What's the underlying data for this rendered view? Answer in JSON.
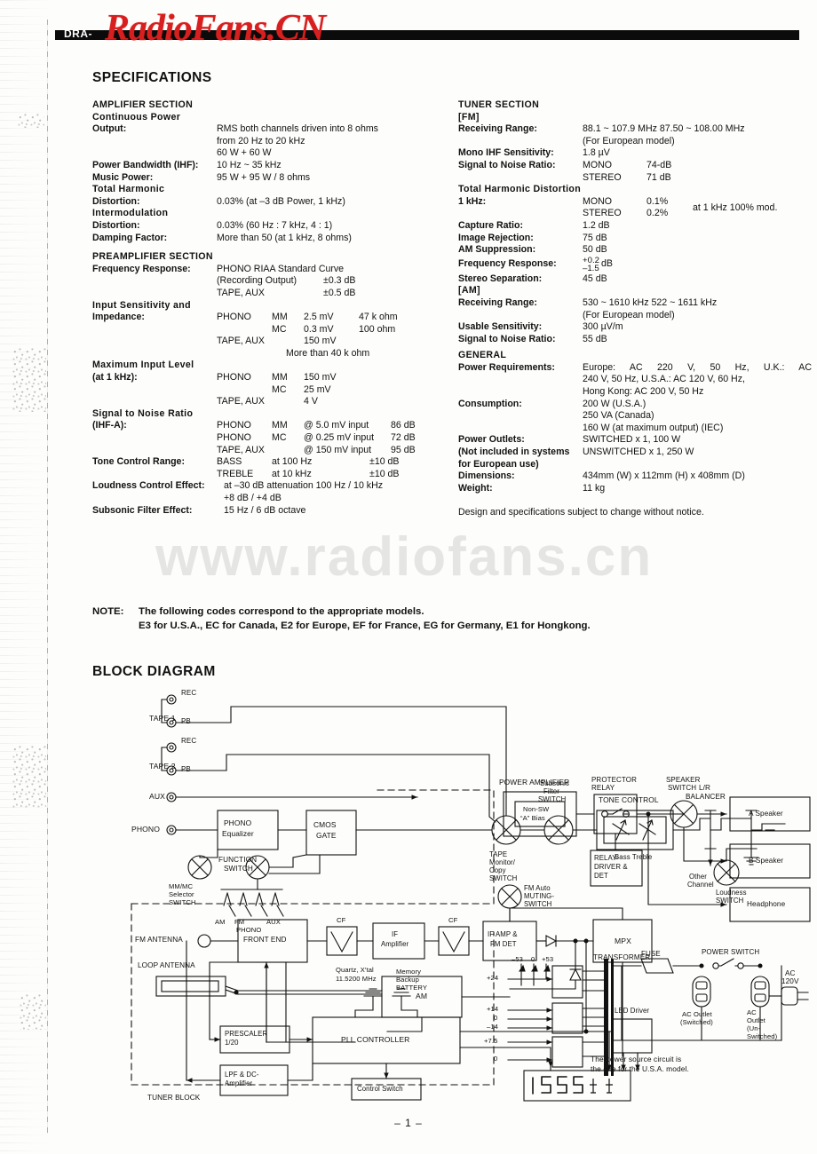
{
  "header": {
    "model_code": "DRA-",
    "watermark_top": "RadioFans.CN",
    "watermark_body": "www.radiofans.cn"
  },
  "specifications": {
    "title": "SPECIFICATIONS",
    "amplifier": {
      "heading": "AMPLIFIER SECTION",
      "continuous_power_head": "Continuous Power",
      "output_label": "Output:",
      "output_lines": [
        "RMS both channels driven into 8 ohms",
        "from 20 Hz to 20 kHz",
        "60 W + 60 W"
      ],
      "power_bandwidth_label": "Power Bandwidth (IHF):",
      "power_bandwidth_value": "10 Hz ~ 35 kHz",
      "music_power_label": "Music Power:",
      "music_power_value": "95 W + 95 W / 8 ohms",
      "thd_head": "Total Harmonic",
      "thd_label": "Distortion:",
      "thd_value": "0.03% (at –3 dB Power, 1 kHz)",
      "imd_head": "Intermodulation",
      "imd_label": "Distortion:",
      "imd_value": "0.03% (60 Hz : 7 kHz, 4 : 1)",
      "damping_label": "Damping Factor:",
      "damping_value": "More than 50 (at 1 kHz, 8 ohms)"
    },
    "preamplifier": {
      "heading": "PREAMPLIFIER SECTION",
      "freq_resp_label": "Frequency Response:",
      "freq_resp_line1": "PHONO RIAA Standard Curve",
      "freq_resp_line2_left": "(Recording Output)",
      "freq_resp_line2_right": "±0.3 dB",
      "freq_resp_line3_left": "TAPE, AUX",
      "freq_resp_line3_right": "±0.5 dB",
      "input_sens_head": "Input Sensitivity and",
      "input_sens_label": "Impedance:",
      "input_sens_rows": [
        {
          "c1": "PHONO",
          "c2": "MM",
          "c3": "2.5 mV",
          "c4": "47 k ohm"
        },
        {
          "c1": "",
          "c2": "MC",
          "c3": "0.3 mV",
          "c4": "100 ohm"
        },
        {
          "c1": "TAPE, AUX",
          "c2": "",
          "c3": "150 mV",
          "c4": ""
        }
      ],
      "input_sens_tail": "More than 40 k ohm",
      "max_input_head": "Maximum Input Level",
      "max_input_label": "(at 1 kHz):",
      "max_input_rows": [
        {
          "c1": "PHONO",
          "c2": "MM",
          "c3": "150 mV"
        },
        {
          "c1": "",
          "c2": "MC",
          "c3": "25 mV"
        },
        {
          "c1": "TAPE, AUX",
          "c2": "",
          "c3": "4 V"
        }
      ],
      "snr_head": "Signal to Noise Ratio",
      "snr_label": "(IHF-A):",
      "snr_rows": [
        {
          "c1": "PHONO",
          "c2": "MM",
          "c3": "@ 5.0 mV input",
          "c4": "86 dB"
        },
        {
          "c1": "PHONO",
          "c2": "MC",
          "c3": "@ 0.25 mV input",
          "c4": "72 dB"
        },
        {
          "c1": "TAPE, AUX",
          "c2": "",
          "c3": "@ 150 mV input",
          "c4": "95 dB"
        }
      ],
      "tone_label": "Tone Control Range:",
      "tone_rows": [
        {
          "c1": "BASS",
          "c2": "at 100 Hz",
          "c3": "±10 dB"
        },
        {
          "c1": "TREBLE",
          "c2": "at 10 kHz",
          "c3": "±10 dB"
        }
      ],
      "loudness_label": "Loudness Control Effect:",
      "loudness_line1": "at –30 dB attenuation  100 Hz / 10 kHz",
      "loudness_line2": "+8 dB / +4 dB",
      "subsonic_label": "Subsonic Filter Effect:",
      "subsonic_value": "15 Hz / 6 dB octave"
    },
    "tuner": {
      "heading": "TUNER SECTION",
      "fm_heading": "[FM]",
      "recv_label": "Receiving Range:",
      "recv_line1": "88.1 ~ 107.9 MHz 87.50 ~ 108.00 MHz",
      "recv_line2": "(For European model)",
      "mono_sens_label": "Mono IHF Sensitivity:",
      "mono_sens_value": "1.8 µV",
      "snr_label": "Signal to Noise Ratio:",
      "snr_rows": [
        {
          "c1": "MONO",
          "c2": "74-dB"
        },
        {
          "c1": "STEREO",
          "c2": "71 dB"
        }
      ],
      "thd_head": "Total Harmonic Distortion",
      "thd_label": "1 kHz:",
      "thd_rows": [
        {
          "c1": "MONO",
          "c2": "0.1%"
        },
        {
          "c1": "STEREO",
          "c2": "0.2%"
        }
      ],
      "thd_note": "at 1 kHz 100% mod.",
      "capture_label": "Capture Ratio:",
      "capture_value": "1.2 dB",
      "image_label": "Image Rejection:",
      "image_value": "75 dB",
      "amsup_label": "AM Suppression:",
      "amsup_value": "50 dB",
      "freq_label": "Frequency Response:",
      "freq_plus": "+0.2",
      "freq_minus": "–1.5",
      "freq_unit": "dB",
      "sep_label": "Stereo Separation:",
      "sep_value": "45 dB",
      "am_heading": "[AM]",
      "am_recv_label": "Receiving Range:",
      "am_recv_line1": "530  ~  1610  kHz  522  ~  1611  kHz",
      "am_recv_line2": "(For European model)",
      "usable_label": "Usable Sensitivity:",
      "usable_value": "300 µV/m",
      "am_snr_label": "Signal to Noise Ratio:",
      "am_snr_value": "55 dB"
    },
    "general": {
      "heading": "GENERAL",
      "power_label": "Power Requirements:",
      "power_lines": [
        "Europe: AC 220 V, 50 Hz, U.K.: AC",
        "240 V, 50 Hz, U.S.A.: AC 120 V, 60 Hz,",
        "Hong Kong: AC 200 V, 50 Hz"
      ],
      "consumption_label": "Consumption:",
      "consumption_lines": [
        "200 W (U.S.A.)",
        "250 VA (Canada)",
        "160 W (at maximum output) (IEC)"
      ],
      "outlets_label": "Power Outlets:",
      "outlets_note1": "(Not included in systems",
      "outlets_note2": "for European use)",
      "outlets_value1": "SWITCHED x 1, 100 W",
      "outlets_value2": "UNSWITCHED x 1, 250 W",
      "dimensions_label": "Dimensions:",
      "dimensions_value": "434mm (W) x 112mm (H) x 408mm (D)",
      "weight_label": "Weight:",
      "weight_value": "11 kg",
      "design_note": "Design and specifications subject to change without notice."
    }
  },
  "note": {
    "label": "NOTE:",
    "line1": "The following codes correspond to the appropriate models.",
    "line2": "E3 for U.S.A., EC for Canada, E2 for Europe, EF for France, EG for Germany, E1 for Hongkong."
  },
  "block_diagram": {
    "title": "BLOCK DIAGRAM",
    "labels": {
      "tape1": "TAPE 1",
      "tape2": "TAPE 2",
      "rec": "REC",
      "pb": "PB",
      "aux": "AUX",
      "phono": "PHONO",
      "phono_equalizer_l1": "PHONO",
      "phono_equalizer_l2": "Equalizer",
      "cmos_gate_l1": "CMOS",
      "cmos_gate_l2": "GATE",
      "function_switch_l1": "FUNCTION",
      "function_switch_l2": "SWITCH",
      "mmmc_l1": "MM/MC",
      "mmmc_l2": "Selector",
      "mmmc_l3": "SWITCH",
      "src_am": "AM",
      "src_fm": "FM",
      "src_aux": "AUX",
      "src_phono": "PHONO",
      "tape_monitor_l1": "TAPE",
      "tape_monitor_l2": "Monitor/",
      "tape_monitor_l3": "Copy",
      "tape_monitor_l4": "SWITCH",
      "subsonic_l1": "Subsonic",
      "subsonic_l2": "Filter",
      "subsonic_l3": "SWITCH",
      "tone_control": "TONE CONTROL",
      "bass_treble": "Bass Treble",
      "balancer_l1": "L/R",
      "balancer_l2": "BALANCER",
      "other_channel_l1": "Other",
      "other_channel_l2": "Channel",
      "loudness_l1": "Loudness",
      "loudness_l2": "SWITCH",
      "power_amplifier": "POWER AMPLIFIER",
      "non_sw_l1": "Non-SW",
      "non_sw_l2": "“A” Bias",
      "protector_l1": "PROTECTOR",
      "protector_l2": "RELAY",
      "relay_driver_l1": "RELAY-",
      "relay_driver_l2": "DRIVER &",
      "relay_driver_l3": "DET",
      "speaker_switch_l1": "SPEAKER",
      "speaker_switch_l2": "SWITCH",
      "a_speaker": "A Speaker",
      "b_speaker": "B Speaker",
      "headphone": "Headphone",
      "fm_antenna": "FM ANTENNA",
      "loop_antenna": "LOOP ANTENNA",
      "front_end": "FRONT END",
      "cf": "CF",
      "if_amplifier_l1": "IF",
      "if_amplifier_l2": "Amplifier",
      "if_amp_fm_det_l1": "IF AMP &",
      "if_amp_fm_det_l2": "FM DET",
      "mpx": "MPX",
      "fm_muting_l1": "FM Auto",
      "fm_muting_l2": "MUTING-",
      "fm_muting_l3": "SWITCH",
      "am": "AM",
      "quartz_l1": "Quartz, X'tal",
      "quartz_l2": "11.5200 MHz",
      "memory_l1": "Memory",
      "memory_l2": "Backup",
      "memory_l3": "BATTERY",
      "prescaler_l1": "PRESCALER",
      "prescaler_l2": "1/20",
      "pll_controller": "PLL CONTROLLER",
      "lpf_l1": "LPF & DC-",
      "lpf_l2": "Amplifier",
      "control_switch": "Control Switch",
      "led_driver": "LED Driver",
      "tuner_block": "TUNER BLOCK",
      "transformer": "TRANSFORMER",
      "fuse": "FUSE",
      "power_switch": "POWER SWITCH",
      "ac_120v_l1": "AC",
      "ac_120v_l2": "120V",
      "ac_outlet_sw_l1": "AC Outlet",
      "ac_outlet_sw_l2": "(Switched)",
      "ac_outlet_unsw_l1": "AC",
      "ac_outlet_unsw_l2": "Outlet",
      "ac_outlet_unsw_l3": "(Un-",
      "ac_outlet_unsw_l4": "Switched)",
      "rail_m53": "–53",
      "rail_0a": "0",
      "rail_p53": "+53",
      "rail_p24": "+24",
      "rail_p14": "+14",
      "rail_0b": "0",
      "rail_m14": "–14",
      "rail_p75": "+7.5",
      "rail_0c": "0",
      "usa_note_l1": "The power source circuit is",
      "usa_note_l2": "the one for the U.S.A. model."
    }
  },
  "footer": {
    "page_number": "– 1 –"
  }
}
